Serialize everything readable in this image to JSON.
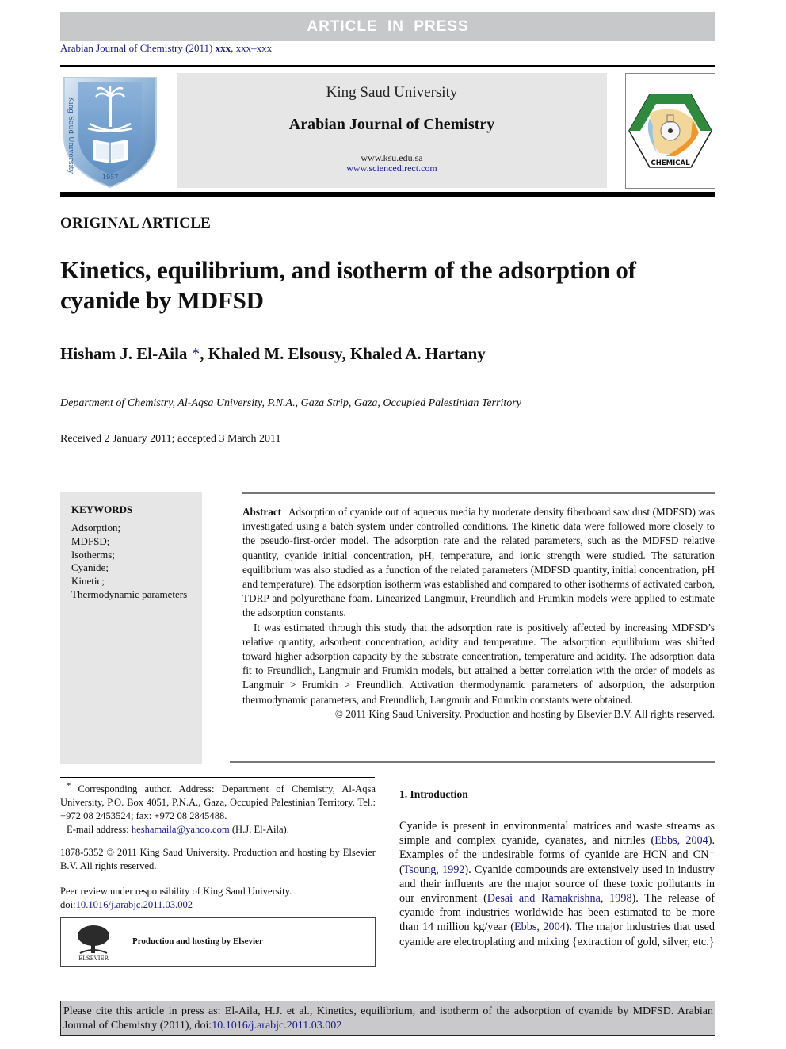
{
  "banner": {
    "text": "ARTICLE IN PRESS"
  },
  "journal_ref": {
    "prefix": "Arabian Journal of Chemistry (2011) ",
    "volume": "xxx",
    "pages": ", xxx–xxx"
  },
  "header": {
    "left_logo": "king-saud-university-logo",
    "institution": "King Saud University",
    "journal_name": "Arabian Journal of Chemistry",
    "url_1": "www.ksu.edu.sa",
    "url_2": "www.sciencedirect.com",
    "right_logo": "saudi-chemical-society-logo",
    "right_logo_text": "CHEMICAL"
  },
  "article": {
    "type": "ORIGINAL ARTICLE",
    "title": "Kinetics, equilibrium, and isotherm of the adsorption of cyanide by MDFSD",
    "authors": {
      "first": "Hisham J. El-Aila ",
      "star": "*",
      "rest": ", Khaled M. Elsousy, Khaled A. Hartany"
    },
    "affiliation": "Department of Chemistry, Al-Aqsa University, P.N.A., Gaza Strip, Gaza, Occupied Palestinian Territory",
    "received": "Received 2 January 2011; accepted 3 March 2011"
  },
  "keywords": {
    "heading": "KEYWORDS",
    "items": [
      "Adsorption;",
      "MDFSD;",
      "Isotherms;",
      "Cyanide;",
      "Kinetic;",
      "Thermodynamic parameters"
    ]
  },
  "abstract": {
    "label": "Abstract",
    "para_1": "Adsorption of cyanide out of aqueous media by moderate density fiberboard saw dust (MDFSD) was investigated using a batch system under controlled conditions. The kinetic data were followed more closely to the pseudo-first-order model. The adsorption rate and the related parameters, such as the MDFSD relative quantity, cyanide initial concentration, pH, temperature, and ionic strength were studied. The saturation equilibrium was also studied as a function of the related parameters (MDFSD quantity, initial concentration, pH and temperature). The adsorption isotherm was established and compared to other isotherms of activated carbon, TDRP and polyurethane foam. Linearized Langmuir, Freundlich and Frumkin models were applied to estimate the adsorption constants.",
    "para_2": "It was estimated through this study that the adsorption rate is positively affected by increasing MDFSD’s relative quantity, adsorbent concentration, acidity and temperature. The adsorption equilibrium was shifted toward higher adsorption capacity by the substrate concentration, temperature and acidity. The adsorption data fit to Freundlich, Langmuir and Frumkin models, but attained a better correlation with the order of models as Langmuir > Frumkin > Freundlich. Activation thermodynamic parameters of adsorption, the adsorption thermodynamic parameters, and Freundlich, Langmuir and Frumkin constants were obtained.",
    "copyright": "© 2011 King Saud University. Production and hosting by Elsevier B.V. All rights reserved."
  },
  "footnote": {
    "star": "*",
    "corresponding": " Corresponding author. Address: Department of Chemistry, Al-Aqsa University, P.O. Box 4051, P.N.A., Gaza, Occupied Palestinian Territory. Tel.: +972 08 2453524; fax: +972 08 2845488.",
    "email_label": "E-mail address: ",
    "email": "heshamaila@yahoo.com",
    "email_suffix": " (H.J. El-Aila).",
    "issn": "1878-5352 © 2011 King Saud University. Production and hosting by Elsevier B.V. All rights reserved.",
    "peer_review": "Peer review under responsibility of King Saud University.",
    "doi_label": "doi:",
    "doi": "10.1016/j.arabjc.2011.03.002",
    "elsevier_box_text": "Production and hosting by Elsevier",
    "elsevier_logo_text": "ELSEVIER"
  },
  "intro": {
    "heading": "1. Introduction",
    "segments": [
      {
        "t": "Cyanide is present in environmental matrices and waste streams as simple and complex cyanide, cyanates, and nitriles ("
      },
      {
        "t": "Ebbs, 2004",
        "link": true
      },
      {
        "t": "). Examples of the undesirable forms of cyanide are HCN and CN⁻ ("
      },
      {
        "t": "Tsoung, 1992",
        "link": true
      },
      {
        "t": "). Cyanide compounds are extensively used in industry and their influents are the major source of these toxic pollutants in our environment ("
      },
      {
        "t": "Desai and Ramakrishna, 1998",
        "link": true
      },
      {
        "t": "). The release of cyanide from industries worldwide has been estimated to be more than 14 million kg/year ("
      },
      {
        "t": "Ebbs, 2004",
        "link": true
      },
      {
        "t": "). The major industries that used cyanide are electroplating and mixing {extraction of gold, silver, etc.}"
      }
    ]
  },
  "cite": {
    "text": "Please cite this article in press as: El-Aila, H.J. et al., Kinetics, equilibrium, and isotherm of the adsorption of cyanide by MDFSD. Arabian Journal of Chemistry (2011), doi:",
    "doi": "10.1016/j.arabjc.2011.03.002"
  },
  "colors": {
    "link": "#1a1a8c",
    "banner_bg": "#c7c8ca",
    "panel_bg": "#e6e6e6",
    "cite_bg": "#c9c9cb",
    "ksu_blue": "#6a9ccc",
    "scs_green": "#2e8b3e",
    "scs_orange": "#f0962a"
  }
}
